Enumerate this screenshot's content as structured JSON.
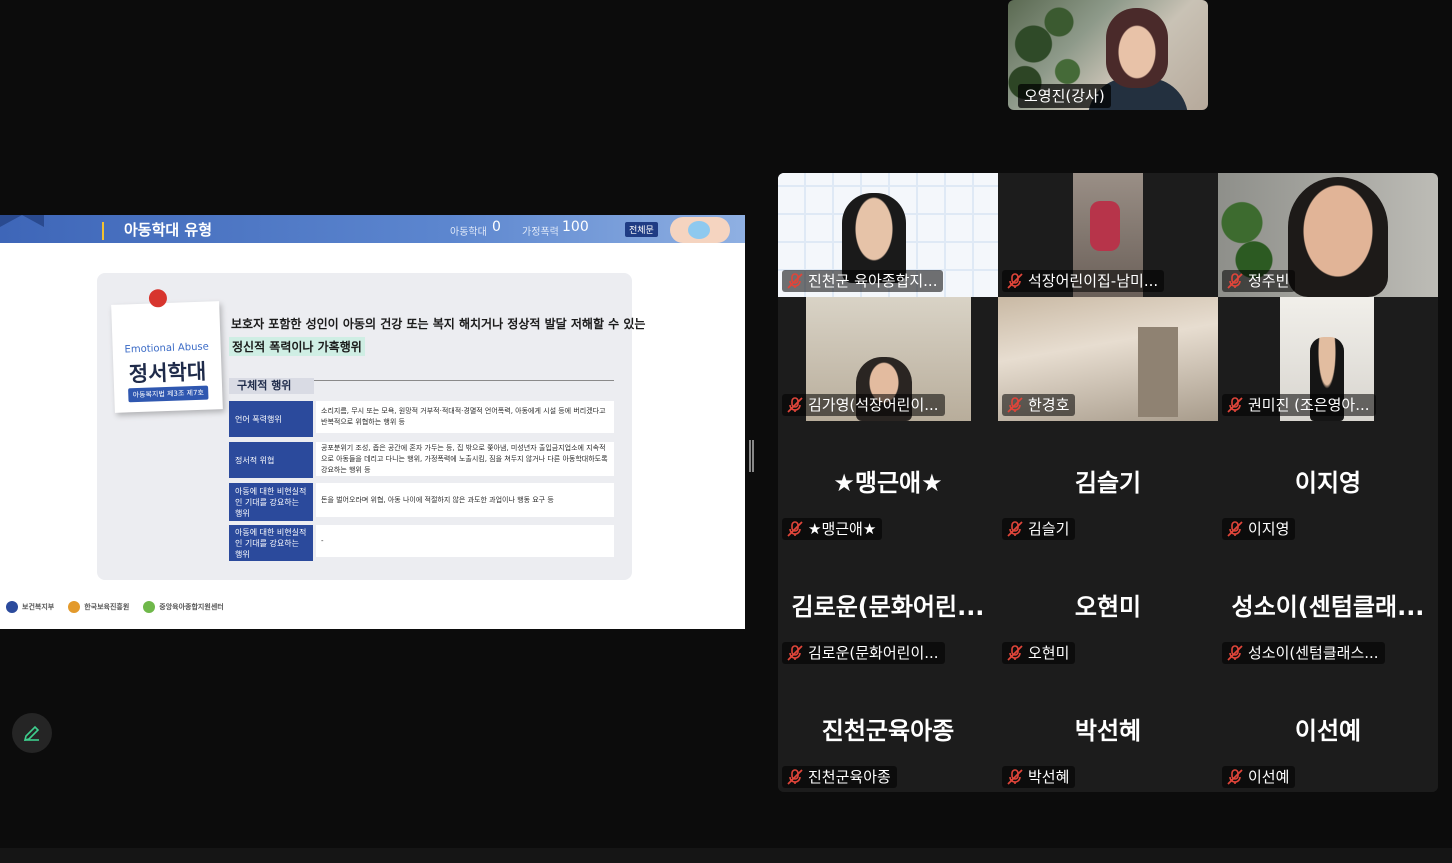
{
  "speaker": {
    "name": "오영진(강사)"
  },
  "slide": {
    "title": "아동학대 유형",
    "progress_label_a": "아동학대",
    "progress_value_a": "0",
    "progress_label_b": "가정폭력",
    "progress_value_b": "100",
    "badge": "전체문",
    "note_en": "Emotional Abuse",
    "note_ko": "정서학대",
    "note_law": "아동복지법 제3조 제7호",
    "definition_line1": "보호자 포함한 성인이 아동의 건강 또는 복지 해치거나 정상적 발달 저해할 수 있는",
    "definition_line2": "정신적 폭력이나 가혹행위",
    "sub_header": "구체적 행위",
    "rows": [
      {
        "label": "언어 폭력행위",
        "desc": "소리지름, 무시 또는 모욕, 원망적 거부적·적대적·경멸적 언어폭력, 아동에게 시설 등에 버리겠다고 반복적으로 위협하는 행위 등"
      },
      {
        "label": "정서적 위협",
        "desc": "공포분위기 조성, 좁은 공간에 혼자 가두는 등, 집 밖으로 쫓아냄, 미성년자 출입금지업소에 지속적으로 아동들을 데리고 다니는 행위, 가정폭력에 노출시킴, 짐을 쳐두지 않거나 다른 아동학대하도록 강요하는 행위 등"
      },
      {
        "label": "아동에 대한 비현실적인 기대를 강요하는 행위",
        "desc": "돈을 벌어오라며 위협, 아동 나이에 적절하지 않은 과도한 과업이나 행동 요구 등"
      },
      {
        "label": "아동에 대한 비현실적인 기대를 강요하는 행위",
        "desc": "-"
      }
    ],
    "footer": [
      "보건복지부",
      "한국보육진흥원",
      "중앙육아종합지원센터"
    ]
  },
  "participants": [
    {
      "name": "진천군 육아종합지...",
      "video": "banner"
    },
    {
      "name": "석장어린이집-남미...",
      "video": "room-red"
    },
    {
      "name": "정주빈",
      "video": "person-plant"
    },
    {
      "name": "김가영(석장어린이...",
      "video": "room-woman"
    },
    {
      "name": "한경호",
      "video": "room-ceiling"
    },
    {
      "name": "권미진 (조은영아...",
      "video": "room-standing"
    },
    {
      "name": "★맹근애★",
      "big": "★맹근애★"
    },
    {
      "name": "김슬기",
      "big": "김슬기"
    },
    {
      "name": "이지영",
      "big": "이지영"
    },
    {
      "name": "김로운(문화어린이...",
      "big": "김로운(문화어린..."
    },
    {
      "name": "오현미",
      "big": "오현미"
    },
    {
      "name": "성소이(센텀클래스...",
      "big": "성소이(센텀클래..."
    },
    {
      "name": "진천군육아종",
      "big": "진천군육아종"
    },
    {
      "name": "박선혜",
      "big": "박선혜"
    },
    {
      "name": "이선예",
      "big": "이선예"
    }
  ],
  "colors": {
    "background": "#0c0c0c",
    "grid": "#1c1c1c",
    "slide_accent": "#2b4a9c",
    "mute_red": "#e0453a"
  },
  "icons": {
    "mute": "microphone-muted-icon",
    "annotate": "pen-icon"
  }
}
